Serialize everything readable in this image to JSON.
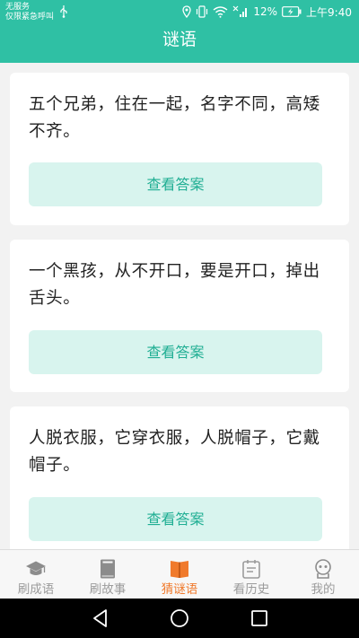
{
  "status": {
    "carrier_line1": "无服务",
    "carrier_line2": "仅限紧急呼叫",
    "battery": "12%",
    "time": "上午9:40"
  },
  "header": {
    "title": "谜语"
  },
  "riddles": [
    {
      "text": "五个兄弟，住在一起，名字不同，高矮不齐。",
      "button": "查看答案"
    },
    {
      "text": "一个黑孩，从不开口，要是开口，掉出舌头。",
      "button": "查看答案"
    },
    {
      "text": "人脱衣服，它穿衣服，人脱帽子，它戴帽子。",
      "button": "查看答案"
    }
  ],
  "tabs": [
    {
      "label": "刷成语",
      "icon": "graduation-cap-icon",
      "active": false
    },
    {
      "label": "刷故事",
      "icon": "book-icon",
      "active": false
    },
    {
      "label": "猜谜语",
      "icon": "open-book-icon",
      "active": true
    },
    {
      "label": "看历史",
      "icon": "calendar-icon",
      "active": false
    },
    {
      "label": "我的",
      "icon": "robot-avatar-icon",
      "active": false
    }
  ],
  "colors": {
    "brand": "#2fc0a4",
    "answer_button_bg": "#d8f4ee",
    "answer_button_text": "#1fae93",
    "tab_active": "#f07a2c",
    "tab_inactive": "#9b9b9b"
  }
}
